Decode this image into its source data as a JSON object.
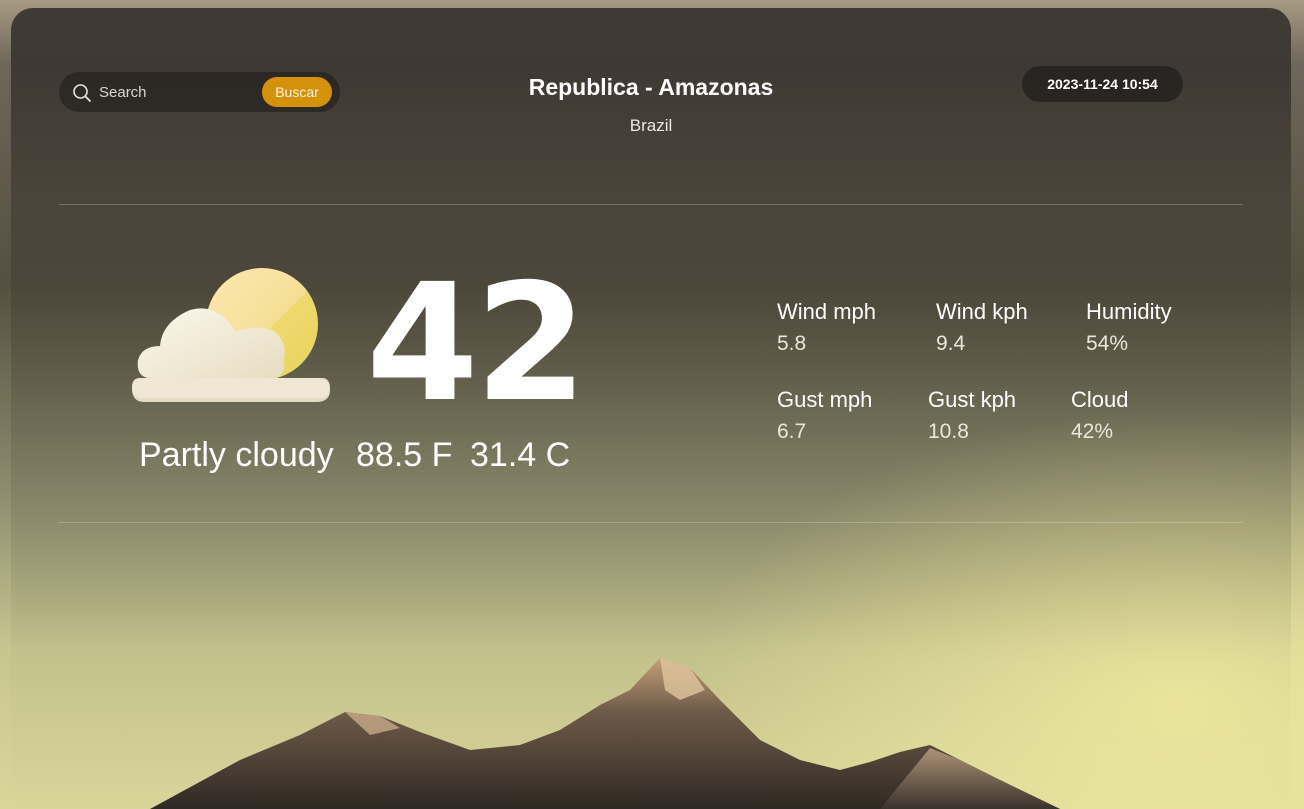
{
  "search": {
    "placeholder": "Search",
    "button_label": "Buscar"
  },
  "location": {
    "title": "Republica - Amazonas",
    "country": "Brazil"
  },
  "datetime": "2023-11-24 10:54",
  "current": {
    "temperature": "42",
    "condition": "Partly cloudy",
    "temp_f": "88.5 F",
    "temp_c": "31.4 C",
    "icon": "partly-cloudy-icon"
  },
  "stats": [
    {
      "label": "Wind mph",
      "value": "5.8"
    },
    {
      "label": "Wind kph",
      "value": "9.4"
    },
    {
      "label": "Humidity",
      "value": "54%"
    },
    {
      "label": "Gust mph",
      "value": "6.7"
    },
    {
      "label": "Gust kph",
      "value": "10.8"
    },
    {
      "label": "Cloud",
      "value": "42%"
    }
  ],
  "colors": {
    "accent": "#d4920c",
    "text": "#ffffff"
  }
}
